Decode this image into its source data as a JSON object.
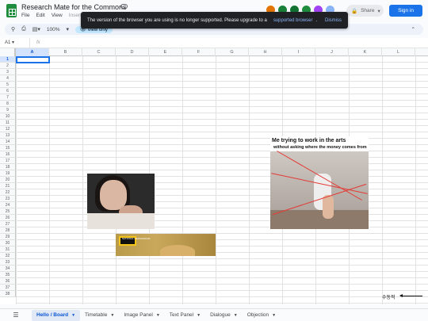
{
  "app": {
    "doc_title": "Research Mate for the Commons",
    "menu": [
      "File",
      "Edit",
      "View",
      "Insert"
    ]
  },
  "header": {
    "share_label": "Share",
    "signin_label": "Sign in",
    "avatar_colors": [
      "#e37400",
      "#188038",
      "#137333",
      "#1e8e3e",
      "#a142f4",
      "#8ab4f8"
    ]
  },
  "banner": {
    "message": "The version of the browser you are using is no longer supported. Please upgrade to a",
    "link": "supported browser",
    "separator": ".",
    "dismiss": "Dismiss"
  },
  "toolbar": {
    "zoom": "100%",
    "mode": "View only"
  },
  "formula_bar": {
    "cell_ref": "A1",
    "fx": "fx"
  },
  "grid": {
    "columns": [
      "A",
      "B",
      "C",
      "D",
      "E",
      "F",
      "G",
      "H",
      "I",
      "J",
      "K",
      "L"
    ],
    "rows": [
      "1",
      "2",
      "3",
      "4",
      "5",
      "6",
      "7",
      "8",
      "9",
      "10",
      "11",
      "12",
      "13",
      "14",
      "15",
      "16",
      "17",
      "18",
      "19",
      "20",
      "21",
      "22",
      "23",
      "24",
      "25",
      "26",
      "27",
      "28",
      "29",
      "30",
      "31",
      "32",
      "33",
      "34",
      "35",
      "36",
      "37",
      "38"
    ],
    "selected_cell": "A1"
  },
  "images": {
    "meme_caption_1": "Me trying to work in the arts",
    "meme_caption_2": "without asking where the money comes from",
    "natgeo_label": "NATIONAL GEOGRAPHIC"
  },
  "annotation": {
    "text": "수동적"
  },
  "tabs": [
    {
      "label": "Hello / Board",
      "active": true
    },
    {
      "label": "Timetable",
      "active": false
    },
    {
      "label": "Image Panel",
      "active": false
    },
    {
      "label": "Text Panel",
      "active": false
    },
    {
      "label": "Dialogue",
      "active": false
    },
    {
      "label": "Objection",
      "active": false
    }
  ]
}
